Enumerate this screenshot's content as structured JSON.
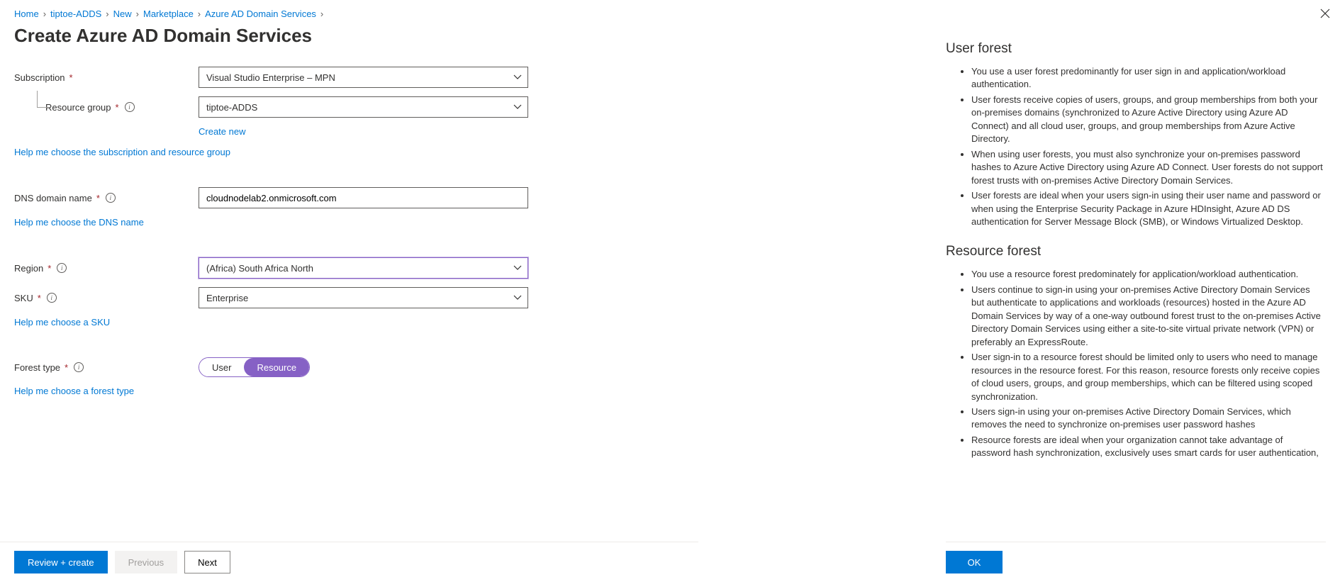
{
  "breadcrumb": [
    "Home",
    "tiptoe-ADDS",
    "New",
    "Marketplace",
    "Azure AD Domain Services"
  ],
  "page_title": "Create Azure AD Domain Services",
  "labels": {
    "subscription": "Subscription",
    "resource_group": "Resource group",
    "dns": "DNS domain name",
    "region": "Region",
    "sku": "SKU",
    "forest_type": "Forest type"
  },
  "values": {
    "subscription": "Visual Studio Enterprise – MPN",
    "resource_group": "tiptoe-ADDS",
    "dns": "cloudnodelab2.onmicrosoft.com",
    "region": "(Africa) South Africa North",
    "sku": "Enterprise"
  },
  "links": {
    "create_new": "Create new",
    "help_sub_rg": "Help me choose the subscription and resource group",
    "help_dns": "Help me choose the DNS name",
    "help_sku": "Help me choose a SKU",
    "help_forest": "Help me choose a forest type"
  },
  "forest_toggle": {
    "option_user": "User",
    "option_resource": "Resource"
  },
  "footer": {
    "review": "Review + create",
    "previous": "Previous",
    "next": "Next"
  },
  "panel": {
    "h_user": "User forest",
    "user_items": [
      "You use a user forest predominantly for user sign in and application/workload authentication.",
      "User forests receive copies of users, groups, and group memberships from both your on-premises domains (synchronized to Azure Active Directory using Azure AD Connect) and all cloud user, groups, and group memberships from Azure Active Directory.",
      "When using user forests, you must also synchronize your on-premises password hashes to Azure Active Directory using Azure AD Connect. User forests do not support forest trusts with on-premises Active Directory Domain Services.",
      "User forests are ideal when your users sign-in using their user name and password or when using the Enterprise Security Package in Azure HDInsight, Azure AD DS authentication for Server Message Block (SMB), or Windows Virtualized Desktop."
    ],
    "h_resource": "Resource forest",
    "resource_items": [
      "You use a resource forest predominately for application/workload authentication.",
      "Users continue to sign-in using your on-premises Active Directory Domain Services but authenticate to applications and workloads (resources) hosted in the Azure AD Domain Services by way of a one-way outbound forest trust to the on-premises Active Directory Domain Services using either a site-to-site virtual private network (VPN) or preferably an ExpressRoute.",
      "User sign-in to a resource forest should be limited only to users who need to manage resources in the resource forest. For this reason, resource forests only receive copies of cloud users, groups, and group memberships, which can be filtered using scoped synchronization.",
      "Users sign-in using your on-premises Active Directory Domain Services, which removes the need to synchronize on-premises user password hashes",
      "Resource forests are ideal when your organization cannot take advantage of password hash synchronization, exclusively uses smart cards for user authentication,"
    ],
    "ok": "OK"
  }
}
